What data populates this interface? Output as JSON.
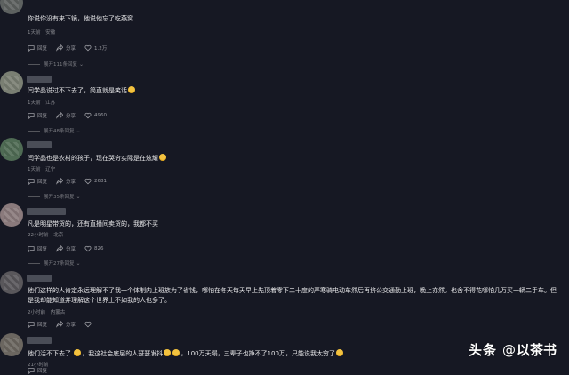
{
  "comments": [
    {
      "text": "你说你没有来下镜，他说他忘了吃燕窝",
      "time": "1天前",
      "location": "安徽",
      "reply_label": "回复",
      "share_label": "分享",
      "likes": "1.2万",
      "expand": "展开111条回复"
    },
    {
      "text": "闫学晶说过不下去了，简直就是笑话",
      "time": "1天前",
      "location": "江苏",
      "reply_label": "回复",
      "share_label": "分享",
      "likes": "4960",
      "expand": "展开48条回复"
    },
    {
      "text": "闫学晶也是农村的孩子，现在哭穷实际是在炫耀",
      "time": "1天前",
      "location": "辽宁",
      "reply_label": "回复",
      "share_label": "分享",
      "likes": "2681",
      "expand": "展开35条回复"
    },
    {
      "text": "凡是明星带货的，还有直播间卖货的，我都不买",
      "time": "22小时前",
      "location": "北京",
      "reply_label": "回复",
      "share_label": "分享",
      "likes": "826",
      "expand": "展开27条回复"
    },
    {
      "text": "他们这样的人肯定永远理解不了我一个体制内上班族为了省钱，哪怕在冬天每天早上先顶着零下二十度的严寒骑电动车然后再挤公交通勤上班，晚上亦然。也舍不得花哪怕几万买一辆二手车。但是我却能知道并理解这个世界上不如我的人也多了。",
      "time": "2小时前",
      "location": "内蒙古",
      "reply_label": "回复",
      "share_label": "分享"
    },
    {
      "text_a": "他们活不下去了",
      "text_b": "，我这社会底层的人瑟瑟发抖",
      "text_c": "，100万天塌，三辈子也挣不了100万，只能说我太穷了",
      "time": "21小时前",
      "reply_label": "回复"
    }
  ],
  "watermark": {
    "brand_cn": "头条",
    "at": "@",
    "author": "以茶书"
  },
  "colors": {
    "background": "#161823",
    "text": "#e8e8ea",
    "meta": "#8a8b91"
  }
}
